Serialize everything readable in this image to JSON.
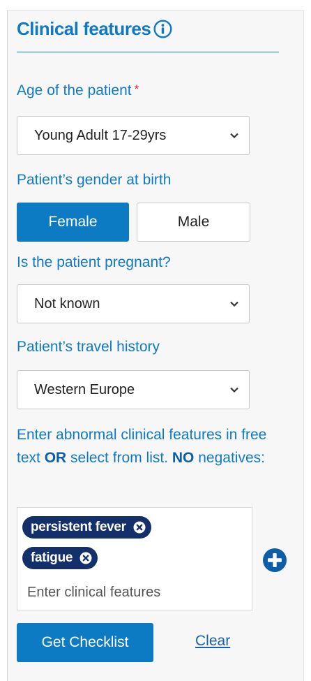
{
  "panel": {
    "title": "Clinical features",
    "info_icon": "info-circle-icon"
  },
  "age": {
    "label": "Age of the patient",
    "required_mark": "*",
    "selected": "Young Adult 17-29yrs"
  },
  "gender": {
    "label": "Patient’s gender at birth",
    "options": [
      "Female",
      "Male"
    ],
    "selected": "Female"
  },
  "pregnant": {
    "label": "Is the patient pregnant?",
    "selected": "Not known"
  },
  "travel": {
    "label": "Patient’s travel history",
    "selected": "Western Europe"
  },
  "features": {
    "prompt_part1": "Enter abnormal clinical features in free text ",
    "prompt_or": "OR",
    "prompt_part2": " select from list. ",
    "prompt_no": "NO",
    "prompt_part3": " negatives:",
    "tags": [
      "persistent fever",
      "fatigue"
    ],
    "input_placeholder": "Enter clinical features",
    "add_icon": "plus-circle-icon",
    "remove_icon": "close-circle-icon"
  },
  "actions": {
    "submit_label": "Get Checklist",
    "clear_label": "Clear"
  },
  "colors": {
    "accent": "#1079c6",
    "primary_button": "#0d7bc4",
    "chip": "#13306b",
    "required": "#e0231f"
  }
}
